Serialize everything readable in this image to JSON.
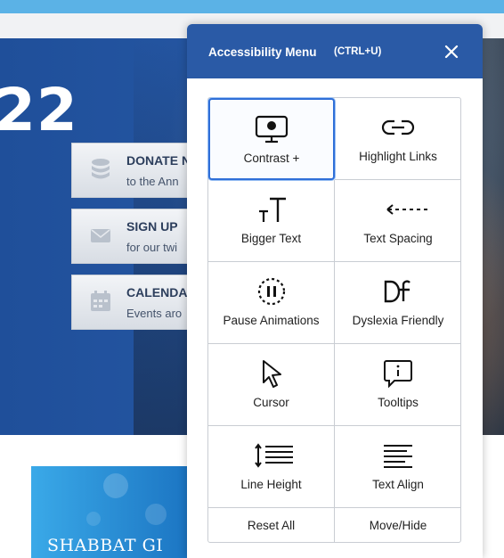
{
  "hero": {
    "year_partial": "22"
  },
  "promos": [
    {
      "title": "DONATE N",
      "subtitle": "to the Ann",
      "icon": "coins-icon"
    },
    {
      "title": "SIGN UP",
      "subtitle": "for our twi",
      "icon": "envelope-icon"
    },
    {
      "title": "CALENDA",
      "subtitle": "Events aro",
      "icon": "calendar-icon"
    }
  ],
  "banner": {
    "text": "SHABBAT GI"
  },
  "menu": {
    "title": "Accessibility Menu",
    "shortcut": "(CTRL+U)",
    "close_icon": "close-icon",
    "tiles": [
      {
        "label": "Contrast +",
        "icon": "monitor-icon",
        "active": true
      },
      {
        "label": "Highlight Links",
        "icon": "link-icon"
      },
      {
        "label": "Bigger Text",
        "icon": "text-size-icon"
      },
      {
        "label": "Text Spacing",
        "icon": "arrows-horizontal-icon"
      },
      {
        "label": "Pause Animations",
        "icon": "pause-icon"
      },
      {
        "label": "Dyslexia Friendly",
        "icon": "dyslexia-font-icon"
      },
      {
        "label": "Cursor",
        "icon": "cursor-icon"
      },
      {
        "label": "Tooltips",
        "icon": "info-bubble-icon"
      },
      {
        "label": "Line Height",
        "icon": "line-height-icon"
      },
      {
        "label": "Text Align",
        "icon": "text-align-icon"
      }
    ],
    "reset_label": "Reset All",
    "move_label": "Move/Hide"
  },
  "colors": {
    "header": "#2a5aa6",
    "accent": "#2f6fd8",
    "hero": "#2556a2"
  }
}
